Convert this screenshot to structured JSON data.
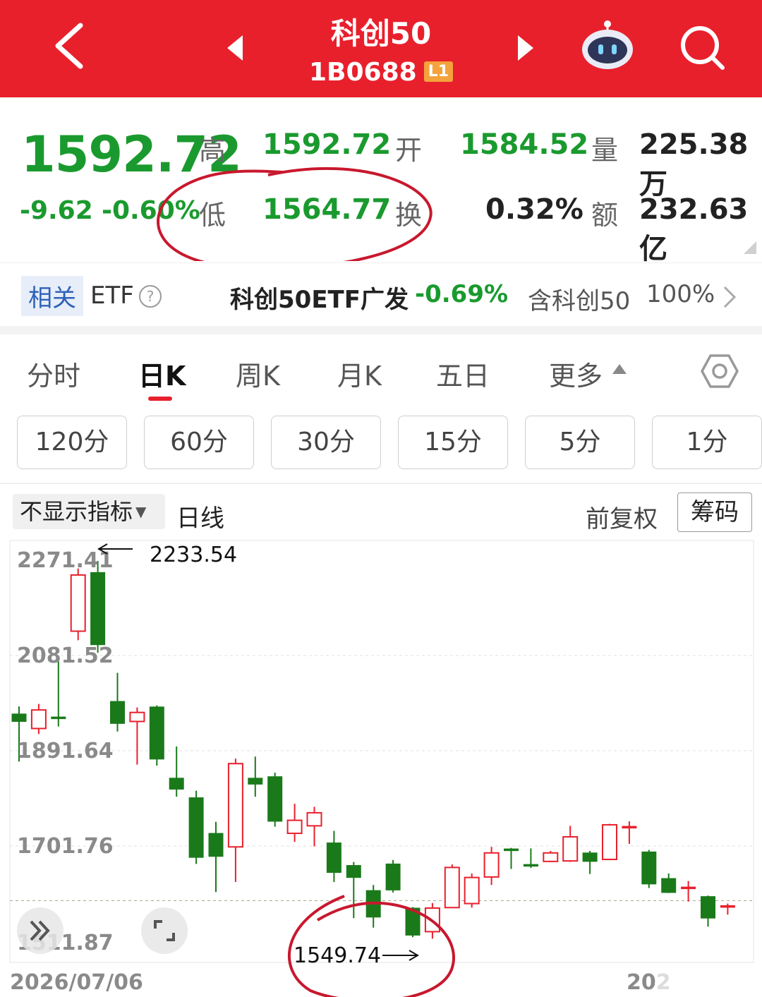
{
  "header": {
    "title": "科创50",
    "code": "1B0688",
    "level_badge": "L1",
    "back_icon": "back-chevron-icon",
    "prev_icon": "prev-arrow-icon",
    "next_icon": "next-arrow-icon",
    "robot_icon": "robot-assistant-icon",
    "search_icon": "search-icon",
    "bg_color": "#e8202c"
  },
  "quote": {
    "price": "1592.72",
    "change": "-9.62",
    "change_pct": "-0.60%",
    "high_label": "高",
    "high": "1592.72",
    "open_label": "开",
    "open": "1584.52",
    "volume_label": "量",
    "volume": "225.38万",
    "low_label": "低",
    "low": "1564.77",
    "turnover_label": "换",
    "turnover": "0.32%",
    "amount_label": "额",
    "amount": "232.63亿",
    "down_color": "#1a9a2e"
  },
  "etf": {
    "tag": "相关",
    "label": "ETF",
    "name": "科创50ETF广发",
    "change_pct": "-0.69%",
    "contains_label": "含科创50",
    "weight": "100%"
  },
  "tabs": [
    {
      "label": "分时"
    },
    {
      "label": "日K",
      "active": true
    },
    {
      "label": "周K"
    },
    {
      "label": "月K"
    },
    {
      "label": "五日"
    },
    {
      "label": "更多"
    }
  ],
  "periods": [
    "120分",
    "60分",
    "30分",
    "15分",
    "5分",
    "1分"
  ],
  "toolbar": {
    "indicator": "不显示指标",
    "line_type": "日线",
    "adjust": "前复权",
    "chips": "筹码"
  },
  "chart_data": {
    "type": "candlestick",
    "y_ticks": [
      "2271.41",
      "2081.52",
      "1891.64",
      "1701.76",
      "1511.87"
    ],
    "ylim": [
      1511.87,
      2271.41
    ],
    "x_start_label": "2026/07/06",
    "x_end_label": "202",
    "current_price": 1592.72,
    "annotations": {
      "high_note": "2233.54",
      "low_note": "1549.74"
    },
    "up_color": "#e8202c",
    "down_color": "#1a7a1a",
    "candles": [
      {
        "o": 1965,
        "c": 1950,
        "h": 1980,
        "l": 1870
      },
      {
        "o": 1936,
        "c": 1973,
        "h": 1985,
        "l": 1925
      },
      {
        "o": 1959,
        "c": 1959,
        "h": 2070,
        "l": 1940
      },
      {
        "o": 2130,
        "c": 2242,
        "h": 2255,
        "l": 2112
      },
      {
        "o": 2247,
        "c": 2103,
        "h": 2270,
        "l": 2087
      },
      {
        "o": 1990,
        "c": 1946,
        "h": 2047,
        "l": 1930
      },
      {
        "o": 1950,
        "c": 1968,
        "h": 1978,
        "l": 1864
      },
      {
        "o": 1979,
        "c": 1875,
        "h": 1982,
        "l": 1862
      },
      {
        "o": 1837,
        "c": 1815,
        "h": 1900,
        "l": 1800
      },
      {
        "o": 1798,
        "c": 1679,
        "h": 1812,
        "l": 1666
      },
      {
        "o": 1727,
        "c": 1681,
        "h": 1750,
        "l": 1610
      },
      {
        "o": 1700,
        "c": 1866,
        "h": 1876,
        "l": 1630
      },
      {
        "o": 1837,
        "c": 1825,
        "h": 1880,
        "l": 1800
      },
      {
        "o": 1840,
        "c": 1751,
        "h": 1848,
        "l": 1740
      },
      {
        "o": 1727,
        "c": 1753,
        "h": 1786,
        "l": 1710
      },
      {
        "o": 1742,
        "c": 1768,
        "h": 1780,
        "l": 1701
      },
      {
        "o": 1708,
        "c": 1649,
        "h": 1732,
        "l": 1630
      },
      {
        "o": 1663,
        "c": 1639,
        "h": 1670,
        "l": 1558
      },
      {
        "o": 1613,
        "c": 1560,
        "h": 1624,
        "l": 1539
      },
      {
        "o": 1666,
        "c": 1614,
        "h": 1674,
        "l": 1609
      },
      {
        "o": 1578,
        "c": 1524,
        "h": 1580,
        "l": 1520
      },
      {
        "o": 1531,
        "c": 1578,
        "h": 1588,
        "l": 1517
      },
      {
        "o": 1579,
        "c": 1659,
        "h": 1665,
        "l": 1579
      },
      {
        "o": 1587,
        "c": 1639,
        "h": 1647,
        "l": 1579
      },
      {
        "o": 1640,
        "c": 1688,
        "h": 1700,
        "l": 1624
      },
      {
        "o": 1696,
        "c": 1696,
        "h": 1698,
        "l": 1656
      },
      {
        "o": 1665,
        "c": 1665,
        "h": 1697,
        "l": 1658
      },
      {
        "o": 1671,
        "c": 1688,
        "h": 1692,
        "l": 1670
      },
      {
        "o": 1672,
        "c": 1720,
        "h": 1742,
        "l": 1670
      },
      {
        "o": 1688,
        "c": 1671,
        "h": 1692,
        "l": 1646
      },
      {
        "o": 1675,
        "c": 1744,
        "h": 1746,
        "l": 1675
      },
      {
        "o": 1741,
        "c": 1741,
        "h": 1751,
        "l": 1706
      },
      {
        "o": 1690,
        "c": 1626,
        "h": 1694,
        "l": 1618
      },
      {
        "o": 1637,
        "c": 1609,
        "h": 1647,
        "l": 1608
      },
      {
        "o": 1620,
        "c": 1620,
        "h": 1632,
        "l": 1591
      },
      {
        "o": 1601,
        "c": 1558,
        "h": 1603,
        "l": 1541
      },
      {
        "o": 1583,
        "c": 1583,
        "h": 1587,
        "l": 1565
      }
    ]
  }
}
